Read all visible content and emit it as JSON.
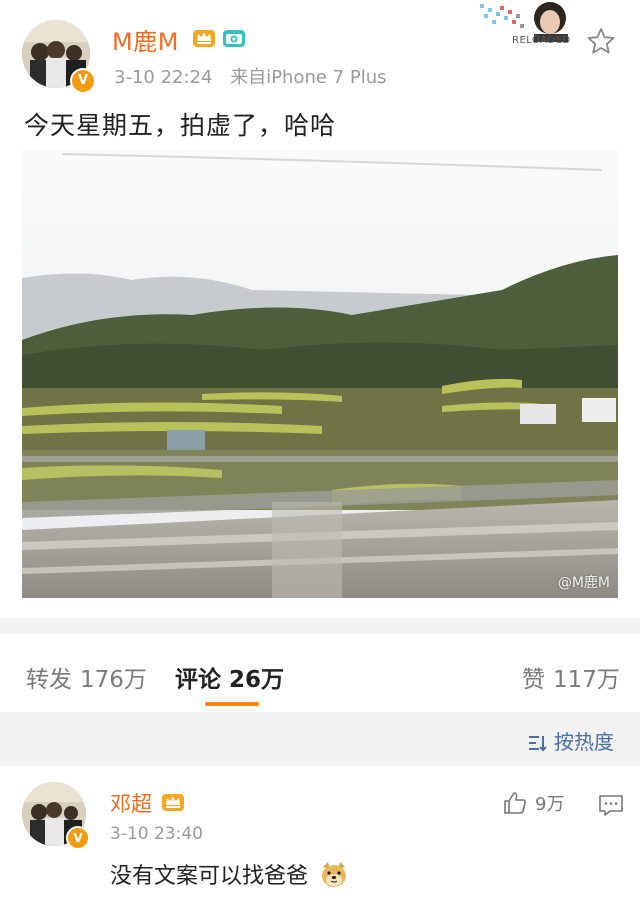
{
  "post": {
    "username": "M鹿M",
    "date": "3-10 22:24",
    "source": "来自iPhone 7 Plus",
    "text": "今天星期五，拍虚了，哈哈",
    "watermark": "@M鹿M"
  },
  "tabs": {
    "repost_label": "转发",
    "repost_count": "176万",
    "comment_label": "评论",
    "comment_count": "26万",
    "like_label": "赞",
    "like_count": "117万"
  },
  "sort": {
    "label": "按热度"
  },
  "comment": {
    "username": "邓超",
    "time": "3-10 23:40",
    "text": "没有文案可以找爸爸",
    "like_count": "9万"
  },
  "corner_badge": {
    "text": "RELOADED"
  },
  "colors": {
    "accent": "#ff8200",
    "username": "#f26c22",
    "link": "#4a6fa5"
  }
}
